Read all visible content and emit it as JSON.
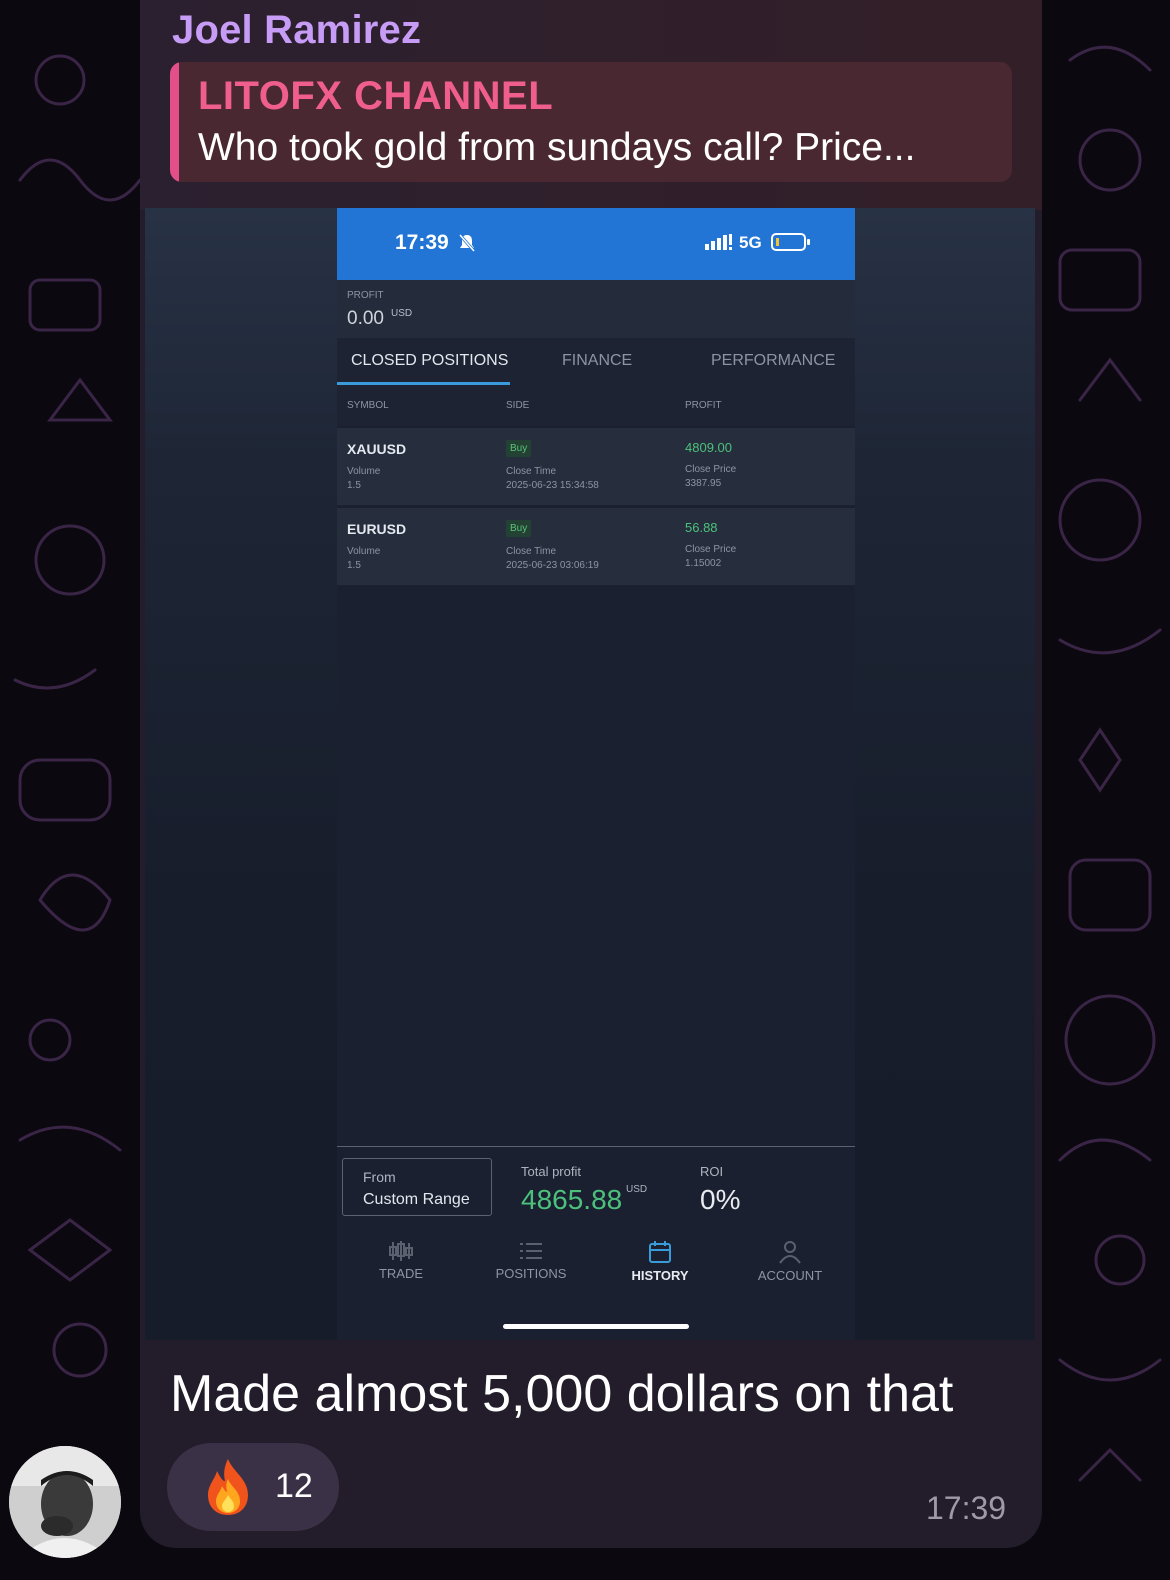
{
  "message": {
    "sender": "Joel Ramirez",
    "reply": {
      "title": "LITOFX CHANNEL",
      "text": "Who took gold from sundays call? Price..."
    },
    "caption": "Made almost 5,000 dollars on that",
    "reaction": {
      "emoji": "fire-icon",
      "count": "12"
    },
    "time": "17:39"
  },
  "screenshot": {
    "statusbar": {
      "time": "17:39",
      "network": "5G"
    },
    "profit": {
      "label": "PROFIT",
      "value": "0.00",
      "unit": "USD"
    },
    "tabs": [
      {
        "label": "CLOSED POSITIONS",
        "active": true
      },
      {
        "label": "FINANCE",
        "active": false
      },
      {
        "label": "PERFORMANCE",
        "active": false
      }
    ],
    "columns": [
      "SYMBOL",
      "SIDE",
      "PROFIT"
    ],
    "rows": [
      {
        "symbol": "XAUUSD",
        "volume_label": "Volume",
        "volume": "1.5",
        "side": "Buy",
        "close_time_label": "Close Time",
        "close_time": "2025-06-23 15:34:58",
        "profit": "4809.00",
        "close_price_label": "Close Price",
        "close_price": "3387.95"
      },
      {
        "symbol": "EURUSD",
        "volume_label": "Volume",
        "volume": "1.5",
        "side": "Buy",
        "close_time_label": "Close Time",
        "close_time": "2025-06-23 03:06:19",
        "profit": "56.88",
        "close_price_label": "Close Price",
        "close_price": "1.15002"
      }
    ],
    "footer": {
      "from_label": "From",
      "range": "Custom Range",
      "total_profit_label": "Total profit",
      "total_profit": "4865.88",
      "total_profit_unit": "USD",
      "roi_label": "ROI",
      "roi": "0%"
    },
    "nav": [
      {
        "label": "TRADE",
        "icon": "candlestick-icon",
        "active": false
      },
      {
        "label": "POSITIONS",
        "icon": "list-icon",
        "active": false
      },
      {
        "label": "HISTORY",
        "icon": "calendar-icon",
        "active": true
      },
      {
        "label": "ACCOUNT",
        "icon": "user-icon",
        "active": false
      }
    ]
  },
  "colors": {
    "sender": "#c79cf6",
    "reply_accent": "#e34f88",
    "statusbar": "#2275d4",
    "profit_green": "#4cc17b",
    "tab_underline": "#3a9bdc"
  }
}
